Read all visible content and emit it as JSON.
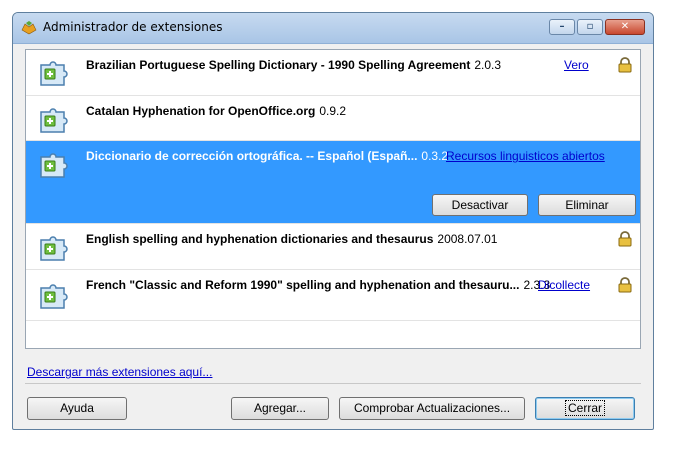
{
  "window": {
    "title": "Administrador de extensiones"
  },
  "extensions": [
    {
      "name": "Brazilian Portuguese Spelling Dictionary - 1990 Spelling Agreement",
      "version": "2.0.3",
      "link": "Vero",
      "locked": true
    },
    {
      "name": "Catalan Hyphenation for OpenOffice.org",
      "version": "0.9.2",
      "link": "",
      "locked": false
    },
    {
      "name": "Diccionario de corrección ortográfica. -- Español (Españ...",
      "version": "0.3.2",
      "link": "Recursos linguisticos abiertos",
      "locked": false,
      "selected": true,
      "buttons": {
        "disable": "Desactivar",
        "remove": "Eliminar"
      }
    },
    {
      "name": "English spelling and hyphenation dictionaries and thesaurus",
      "version": "2008.07.01",
      "link": "",
      "locked": true
    },
    {
      "name": "French \"Classic and Reform 1990\" spelling and hyphenation and thesauru...",
      "version": "2.3.3",
      "link": "Dicollecte",
      "locked": true
    }
  ],
  "footer": {
    "download_link": "Descargar más extensiones aquí...",
    "help": "Ayuda",
    "add": "Agregar...",
    "check_updates": "Comprobar Actualizaciones...",
    "close": "Cerrar"
  },
  "colors": {
    "selection": "#3399ff",
    "link": "#0000cc"
  }
}
